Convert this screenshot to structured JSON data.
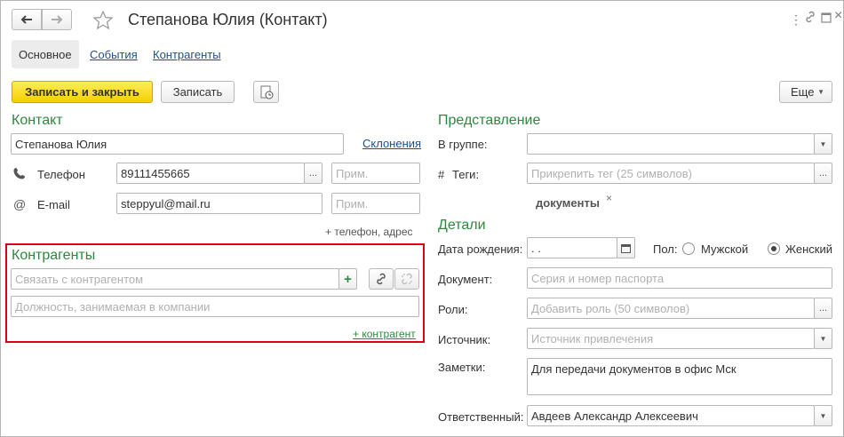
{
  "window": {
    "title": "Степанова Юлия (Контакт)"
  },
  "tabs": [
    {
      "label": "Основное"
    },
    {
      "label": "События"
    },
    {
      "label": "Контрагенты"
    }
  ],
  "toolbar": {
    "save_close": "Записать и закрыть",
    "save": "Записать",
    "more": "Еще"
  },
  "contact": {
    "section_title": "Контакт",
    "name": "Степанова Юлия",
    "declensions_link": "Склонения",
    "phone_label": "Телефон",
    "phone_value": "89111455665",
    "phone_note_placeholder": "Прим.",
    "email_label": "E-mail",
    "email_value": "steppyul@mail.ru",
    "email_note_placeholder": "Прим.",
    "add_link": "+ телефон, адрес"
  },
  "counterparties": {
    "section_title": "Контрагенты",
    "link_placeholder": "Связать с контрагентом",
    "position_placeholder": "Должность, занимаемая в компании",
    "add_link": "+ контрагент"
  },
  "presentation": {
    "section_title": "Представление",
    "group_label": "В группе:",
    "group_value": "",
    "tags_label": "Теги:",
    "tags_placeholder": "Прикрепить тег (25 символов)",
    "tag": "документы"
  },
  "details": {
    "section_title": "Детали",
    "birth_label": "Дата рождения:",
    "birth_value": " .  .",
    "gender_label": "Пол:",
    "gender_male": "Мужской",
    "gender_female": "Женский",
    "gender_selected": "female",
    "document_label": "Документ:",
    "document_placeholder": "Серия и номер паспорта",
    "roles_label": "Роли:",
    "roles_placeholder": "Добавить роль (50 символов)",
    "source_label": "Источник:",
    "source_placeholder": "Источник привлечения",
    "notes_label": "Заметки:",
    "notes_value": "Для передачи документов в офис Мск",
    "responsible_label": "Ответственный:",
    "responsible_value": "Авдеев Александр Алексеевич"
  },
  "colors": {
    "accent_green": "#2b8a3e",
    "primary_yellow": "#f4d000",
    "highlight_red": "#d9001b",
    "link_blue": "#1f4f8e"
  }
}
